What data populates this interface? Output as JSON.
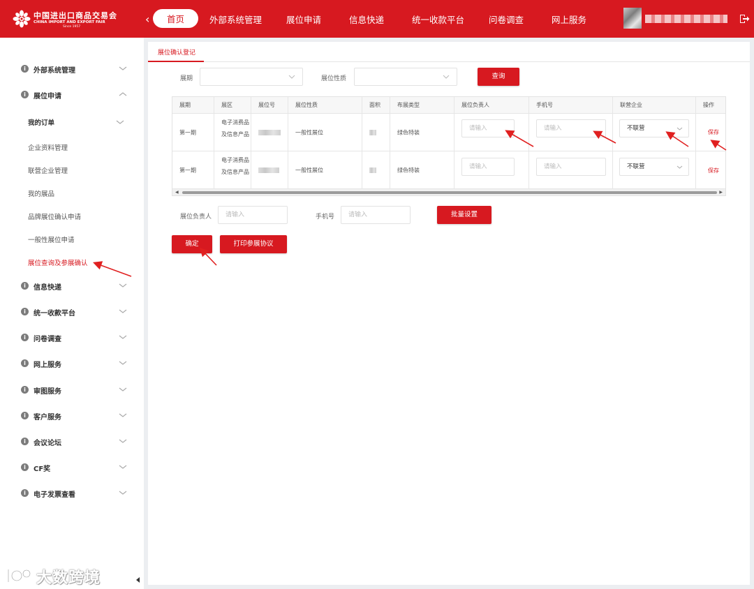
{
  "brand": {
    "cn": "中国进出口商品交易会",
    "en": "CHINA IMPORT AND EXPORT FAIR",
    "since": "Since 1957",
    "color": "#d71920"
  },
  "nav": {
    "items": [
      {
        "label": "首页",
        "active": true
      },
      {
        "label": "外部系统管理"
      },
      {
        "label": "展位申请"
      },
      {
        "label": "信息快递"
      },
      {
        "label": "统一收款平台"
      },
      {
        "label": "问卷调查"
      },
      {
        "label": "网上服务"
      }
    ]
  },
  "sidebar": {
    "groups": [
      {
        "label": "外部系统管理"
      },
      {
        "label": "展位申请",
        "expanded": true
      },
      {
        "label": "信息快递"
      },
      {
        "label": "统一收款平台"
      },
      {
        "label": "问卷调查"
      },
      {
        "label": "网上服务"
      },
      {
        "label": "审图服务"
      },
      {
        "label": "客户服务"
      },
      {
        "label": "会议论坛"
      },
      {
        "label": "CF奖"
      },
      {
        "label": "电子发票查看"
      }
    ],
    "sub": [
      {
        "label": "我的订单",
        "bold": true
      },
      {
        "label": "企业资料管理"
      },
      {
        "label": "联营企业管理"
      },
      {
        "label": "我的展品"
      },
      {
        "label": "品牌展位确认申请"
      },
      {
        "label": "一般性展位申请"
      },
      {
        "label": "展位查询及参展确认",
        "active": true
      }
    ]
  },
  "main": {
    "tab": "展位确认登记",
    "filters": {
      "period_label": "展期",
      "nature_label": "展位性质",
      "query_button": "查询"
    },
    "table": {
      "headers": [
        "展期",
        "展区",
        "展位号",
        "展位性质",
        "面积",
        "布展类型",
        "展位负责人",
        "手机号",
        "联营企业",
        "操作"
      ],
      "rows": [
        {
          "period": "第一期",
          "zone": "电子消费品及信息产品",
          "nature": "一般性展位",
          "decor": "绿色特装",
          "contact_placeholder": "请输入",
          "phone_placeholder": "请输入",
          "partner": "不联营",
          "action": "保存"
        },
        {
          "period": "第一期",
          "zone": "电子消费品及信息产品",
          "nature": "一般性展位",
          "decor": "绿色特装",
          "contact_placeholder": "请输入",
          "phone_placeholder": "请输入",
          "partner": "不联营",
          "action": "保存"
        }
      ]
    },
    "batch": {
      "contact_label": "展位负责人",
      "contact_placeholder": "请输入",
      "phone_label": "手机号",
      "phone_placeholder": "请输入",
      "button": "批量设置"
    },
    "actions": {
      "confirm": "确定",
      "print": "打印参展协议"
    }
  },
  "watermark": "大数跨境"
}
